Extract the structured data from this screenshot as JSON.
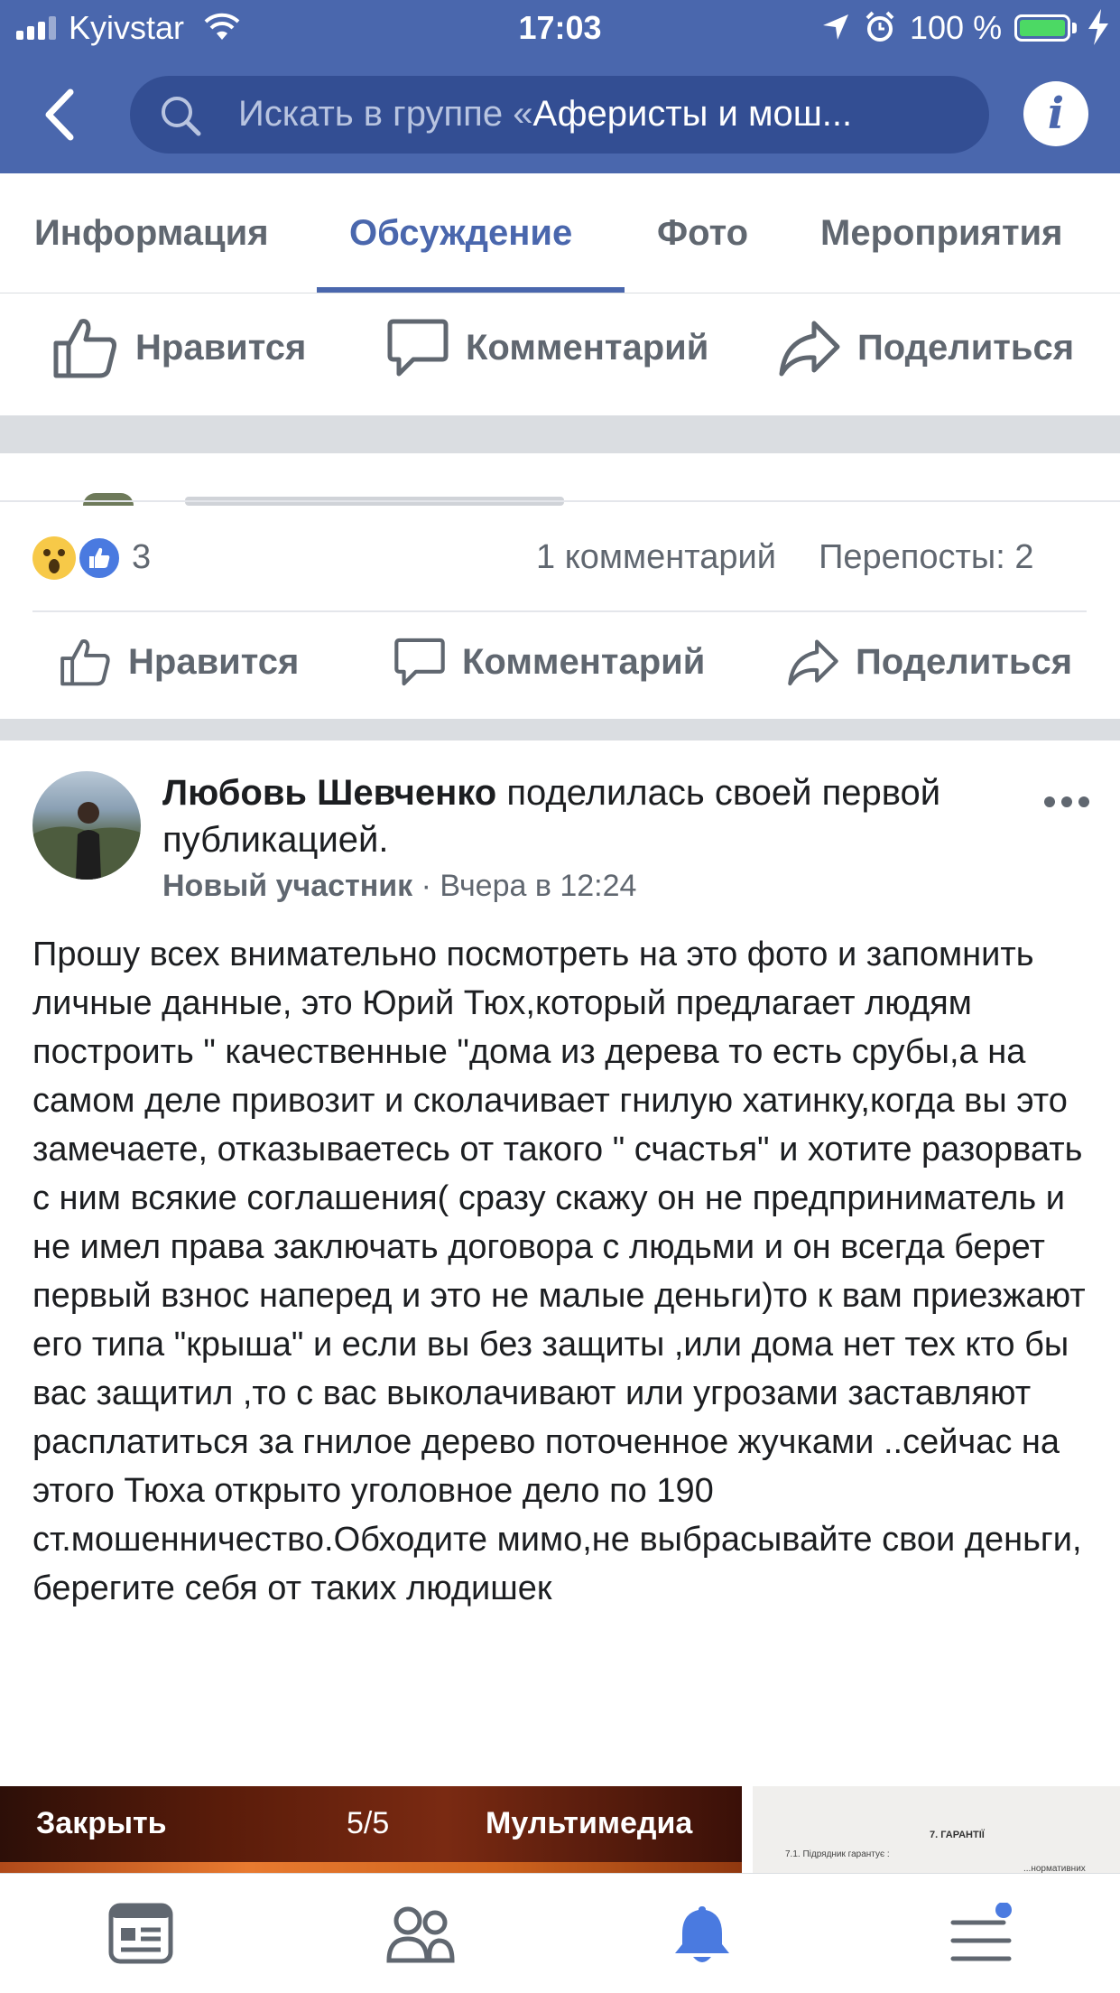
{
  "status_bar": {
    "carrier": "Kyivstar",
    "time": "17:03",
    "battery_percent": "100 %",
    "battery_color": "#4cd964"
  },
  "header": {
    "back_icon": "chevron-left-icon",
    "search_placeholder": "Искать в группе «",
    "search_group_name": "Аферисты и мош...",
    "info_icon": "info-icon",
    "info_glyph": "i",
    "background_color": "#4a67ad"
  },
  "tabs": [
    {
      "label": "Информация",
      "active": false
    },
    {
      "label": "Обсуждение",
      "active": true
    },
    {
      "label": "Фото",
      "active": false
    },
    {
      "label": "Мероприятия",
      "active": false
    }
  ],
  "actions_top": {
    "like": "Нравится",
    "comment": "Комментарий",
    "share": "Поделиться"
  },
  "previous_post": {
    "reaction_icons": [
      "wow-reaction-icon",
      "like-reaction-icon"
    ],
    "reactions_count": "3",
    "comments": "1 комментарий",
    "shares": "Перепосты: 2"
  },
  "actions": {
    "like": "Нравится",
    "comment": "Комментарий",
    "share": "Поделиться"
  },
  "post": {
    "author": "Любовь Шевченко",
    "action_text": "поделилась своей первой публикацией.",
    "badge": "Новый участник",
    "dot": "·",
    "time": "Вчера в 12:24",
    "more_icon": "more-dots-icon",
    "body": "Прошу всех внимательно посмотреть на это фото и запомнить личные данные, это Юрий Тюх,который предлагает людям построить \" качественные \"дома из дерева то есть срубы,а на самом деле привозит и сколачивает гнилую хатинку,когда вы это замечаете, отказываетесь от такого \" счастья\" и хотите разорвать с ним всякие соглашения( сразу скажу он не предприниматель и не имел права заключать договора с людьми и он всегда берет первый взнос наперед и это не малые деньги)то к вам приезжают его типа \"крыша\" и если вы без защиты ,или дома нет тех кто бы вас защитил ,то с вас выколачивают или угрозами заставляют расплатиться за гнилое дерево поточенное жучками ..сейчас на этого Тюха открыто уголовное дело по 190 ст.мошенничество.Обходите мимо,не выбрасывайте свои деньги, берегите себя от таких людишек"
  },
  "media": {
    "close": "Закрыть",
    "counter": "5/5",
    "multimedia": "Мультимедиа",
    "doc_heading": "7. ГАРАНТІЇ",
    "doc_line": "7.1. Підрядник гарантує :",
    "doc_line2": "...нормативних умовами"
  },
  "bottom_nav": [
    {
      "icon": "news-feed-icon",
      "active": false
    },
    {
      "icon": "friends-icon",
      "active": false
    },
    {
      "icon": "notifications-bell-icon",
      "active": true
    },
    {
      "icon": "menu-icon",
      "active": false,
      "badge_dot": true
    }
  ],
  "colors": {
    "accent": "#4a67ad",
    "muted_text": "#606770",
    "body_text": "#1c1e21"
  }
}
